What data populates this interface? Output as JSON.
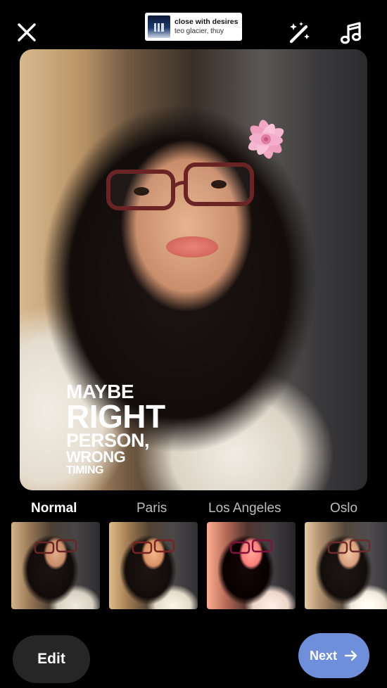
{
  "header": {
    "close_icon": "close-icon",
    "effects_icon": "magic-wand-icon",
    "music_icon": "music-note-icon"
  },
  "music_sticker": {
    "title": "close with desires",
    "artist": "teo glacier, thuy"
  },
  "overlay_text": {
    "line1": "MAYBE",
    "line2": "RIGHT",
    "line3": "PERSON,",
    "line4": "WRONG",
    "line5": "TIMING"
  },
  "filters": [
    {
      "label": "Normal",
      "selected": true
    },
    {
      "label": "Paris",
      "selected": false
    },
    {
      "label": "Los Angeles",
      "selected": false
    },
    {
      "label": "Oslo",
      "selected": false
    }
  ],
  "footer": {
    "edit_label": "Edit",
    "next_label": "Next",
    "next_icon": "arrow-right-icon"
  },
  "colors": {
    "background": "#000000",
    "next_button": "#6f8fda",
    "edit_button": "#262626"
  }
}
